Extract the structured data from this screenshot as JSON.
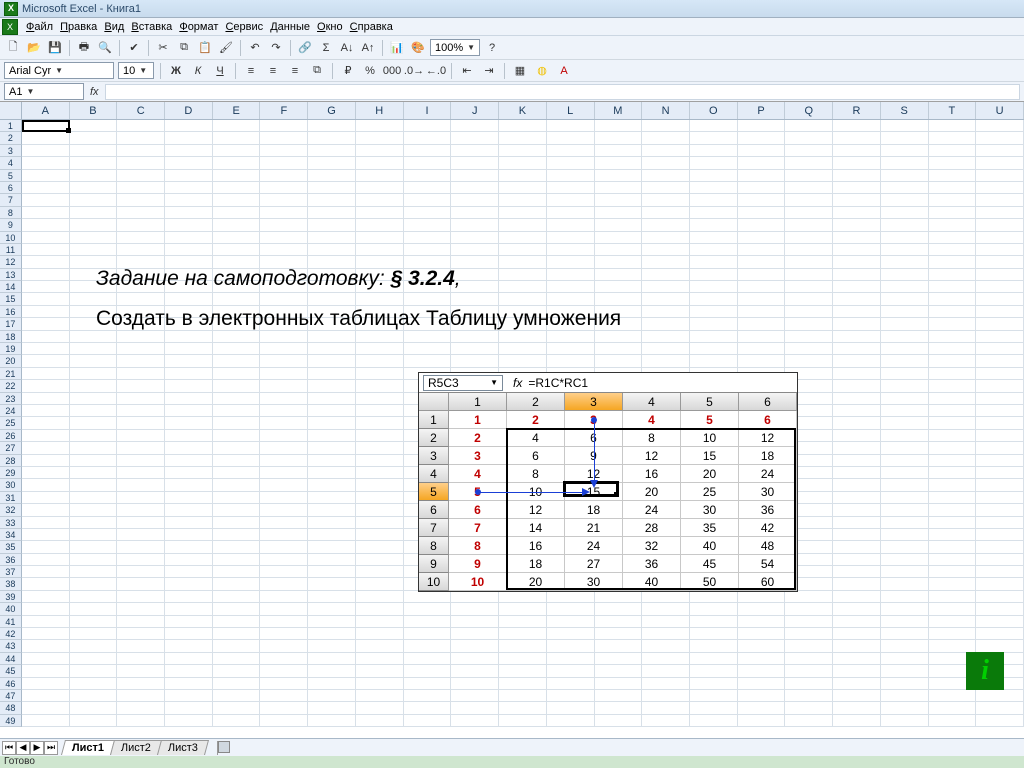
{
  "title": "Microsoft Excel - Книга1",
  "menu": [
    "Файл",
    "Правка",
    "Вид",
    "Вставка",
    "Формат",
    "Сервис",
    "Данные",
    "Окно",
    "Справка"
  ],
  "zoom": "100%",
  "font": {
    "name": "Arial Cyr",
    "size": "10"
  },
  "namebox": "A1",
  "columns": [
    "A",
    "B",
    "C",
    "D",
    "E",
    "F",
    "G",
    "H",
    "I",
    "J",
    "K",
    "L",
    "M",
    "N",
    "O",
    "P",
    "Q",
    "R",
    "S",
    "T",
    "U"
  ],
  "row_count": 49,
  "overlay": {
    "line1_prefix": "Задание на самоподготовку: ",
    "line1_bold": "§ 3.2.4",
    "line1_suffix": ",",
    "line2": "Создать в электронных таблицах Таблицу умножения"
  },
  "mini": {
    "namebox": "R5C3",
    "fx": "fx",
    "formula": "=R1C*RC1",
    "col_headers": [
      "1",
      "2",
      "3",
      "4",
      "5",
      "6"
    ],
    "rows": [
      {
        "h": "1",
        "cells": [
          "1",
          "2",
          "3",
          "4",
          "5",
          "6"
        ],
        "red_all": true
      },
      {
        "h": "2",
        "cells": [
          "2",
          "4",
          "6",
          "8",
          "10",
          "12"
        ]
      },
      {
        "h": "3",
        "cells": [
          "3",
          "6",
          "9",
          "12",
          "15",
          "18"
        ]
      },
      {
        "h": "4",
        "cells": [
          "4",
          "8",
          "12",
          "16",
          "20",
          "24"
        ]
      },
      {
        "h": "5",
        "cells": [
          "5",
          "10",
          "15",
          "20",
          "25",
          "30"
        ]
      },
      {
        "h": "6",
        "cells": [
          "6",
          "12",
          "18",
          "24",
          "30",
          "36"
        ]
      },
      {
        "h": "7",
        "cells": [
          "7",
          "14",
          "21",
          "28",
          "35",
          "42"
        ]
      },
      {
        "h": "8",
        "cells": [
          "8",
          "16",
          "24",
          "32",
          "40",
          "48"
        ]
      },
      {
        "h": "9",
        "cells": [
          "9",
          "18",
          "27",
          "36",
          "45",
          "54"
        ]
      },
      {
        "h": "10",
        "cells": [
          "10",
          "20",
          "30",
          "40",
          "50",
          "60"
        ]
      }
    ],
    "sel_col_index": 2,
    "sel_row_index": 4
  },
  "sheets": [
    "Лист1",
    "Лист2",
    "Лист3"
  ],
  "active_sheet": 0,
  "status": "Готово"
}
